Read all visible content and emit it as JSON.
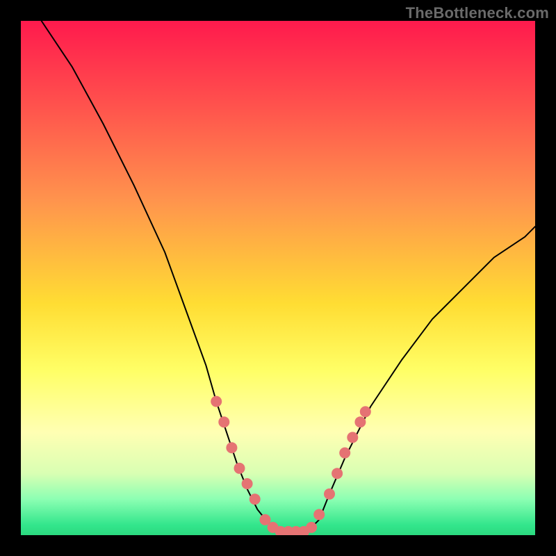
{
  "watermark": "TheBottleneck.com",
  "chart_data": {
    "type": "line",
    "title": "",
    "xlabel": "",
    "ylabel": "",
    "xlim": [
      0,
      100
    ],
    "ylim": [
      0,
      100
    ],
    "background_gradient": {
      "direction": "vertical",
      "stops": [
        {
          "pos": 0,
          "color": "#ff1a4d"
        },
        {
          "pos": 15,
          "color": "#ff4d4d"
        },
        {
          "pos": 35,
          "color": "#ff944d"
        },
        {
          "pos": 55,
          "color": "#ffdd33"
        },
        {
          "pos": 68,
          "color": "#ffff66"
        },
        {
          "pos": 80,
          "color": "#ffffb3"
        },
        {
          "pos": 88,
          "color": "#d9ffb3"
        },
        {
          "pos": 93,
          "color": "#8cffb3"
        },
        {
          "pos": 98,
          "color": "#33e68c"
        },
        {
          "pos": 100,
          "color": "#2bd97f"
        }
      ]
    },
    "series": [
      {
        "name": "bottleneck-curve",
        "stroke": "#000000",
        "stroke_width": 2,
        "x": [
          4,
          10,
          16,
          22,
          28,
          32,
          36,
          38,
          40,
          42,
          44,
          46,
          48,
          50,
          52,
          54,
          56,
          58,
          60,
          63,
          68,
          74,
          80,
          86,
          92,
          98,
          100
        ],
        "y": [
          100,
          91,
          80,
          68,
          55,
          44,
          33,
          26,
          20,
          14,
          9,
          5,
          2.5,
          1,
          0.5,
          0.5,
          1,
          3,
          8,
          15,
          25,
          34,
          42,
          48,
          54,
          58,
          60
        ]
      }
    ],
    "markers": [
      {
        "series": "bottleneck-curve",
        "x": 38.0,
        "y": 26.0,
        "r": 8,
        "color": "#e57373"
      },
      {
        "series": "bottleneck-curve",
        "x": 39.5,
        "y": 22.0,
        "r": 8,
        "color": "#e57373"
      },
      {
        "series": "bottleneck-curve",
        "x": 41.0,
        "y": 17.0,
        "r": 8,
        "color": "#e57373"
      },
      {
        "series": "bottleneck-curve",
        "x": 42.5,
        "y": 13.0,
        "r": 8,
        "color": "#e57373"
      },
      {
        "series": "bottleneck-curve",
        "x": 44.0,
        "y": 10.0,
        "r": 8,
        "color": "#e57373"
      },
      {
        "series": "bottleneck-curve",
        "x": 45.5,
        "y": 7.0,
        "r": 8,
        "color": "#e57373"
      },
      {
        "series": "bottleneck-curve",
        "x": 47.5,
        "y": 3.0,
        "r": 8,
        "color": "#e57373"
      },
      {
        "series": "bottleneck-curve",
        "x": 49.0,
        "y": 1.5,
        "r": 8,
        "color": "#e57373"
      },
      {
        "series": "bottleneck-curve",
        "x": 50.5,
        "y": 0.7,
        "r": 8,
        "color": "#e57373"
      },
      {
        "series": "bottleneck-curve",
        "x": 52.0,
        "y": 0.7,
        "r": 8,
        "color": "#e57373"
      },
      {
        "series": "bottleneck-curve",
        "x": 53.5,
        "y": 0.7,
        "r": 8,
        "color": "#e57373"
      },
      {
        "series": "bottleneck-curve",
        "x": 55.0,
        "y": 0.7,
        "r": 8,
        "color": "#e57373"
      },
      {
        "series": "bottleneck-curve",
        "x": 56.5,
        "y": 1.5,
        "r": 8,
        "color": "#e57373"
      },
      {
        "series": "bottleneck-curve",
        "x": 58.0,
        "y": 4.0,
        "r": 8,
        "color": "#e57373"
      },
      {
        "series": "bottleneck-curve",
        "x": 60.0,
        "y": 8.0,
        "r": 8,
        "color": "#e57373"
      },
      {
        "series": "bottleneck-curve",
        "x": 61.5,
        "y": 12.0,
        "r": 8,
        "color": "#e57373"
      },
      {
        "series": "bottleneck-curve",
        "x": 63.0,
        "y": 16.0,
        "r": 8,
        "color": "#e57373"
      },
      {
        "series": "bottleneck-curve",
        "x": 64.5,
        "y": 19.0,
        "r": 8,
        "color": "#e57373"
      },
      {
        "series": "bottleneck-curve",
        "x": 66.0,
        "y": 22.0,
        "r": 8,
        "color": "#e57373"
      },
      {
        "series": "bottleneck-curve",
        "x": 67.0,
        "y": 24.0,
        "r": 8,
        "color": "#e57373"
      }
    ]
  }
}
